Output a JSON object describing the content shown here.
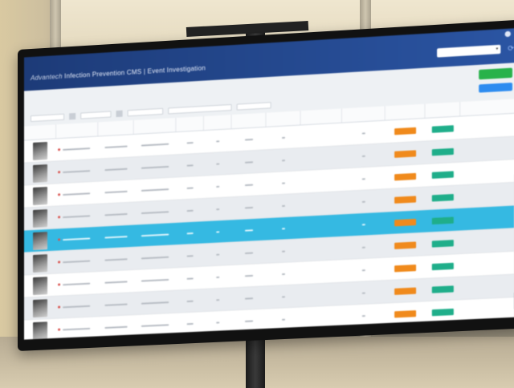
{
  "app": {
    "brand": "Advantech",
    "title": "Infection Prevention CMS | Event Investigation"
  },
  "header": {
    "select_project_label": "",
    "select_project_value": ""
  },
  "table": {
    "columns": [
      "",
      "",
      "",
      "",
      "",
      "",
      "",
      "",
      "",
      "",
      "",
      ""
    ],
    "row_count": 9,
    "selected_row": 4
  },
  "colors": {
    "header_blue": "#1d3b78",
    "selected_row": "#35b9e2",
    "status_orange": "#f08a1c",
    "operation_green": "#1fae8a",
    "export_green": "#28b24a"
  },
  "icons": [
    "refresh-icon",
    "chevron-down-icon",
    "user-icon"
  ]
}
